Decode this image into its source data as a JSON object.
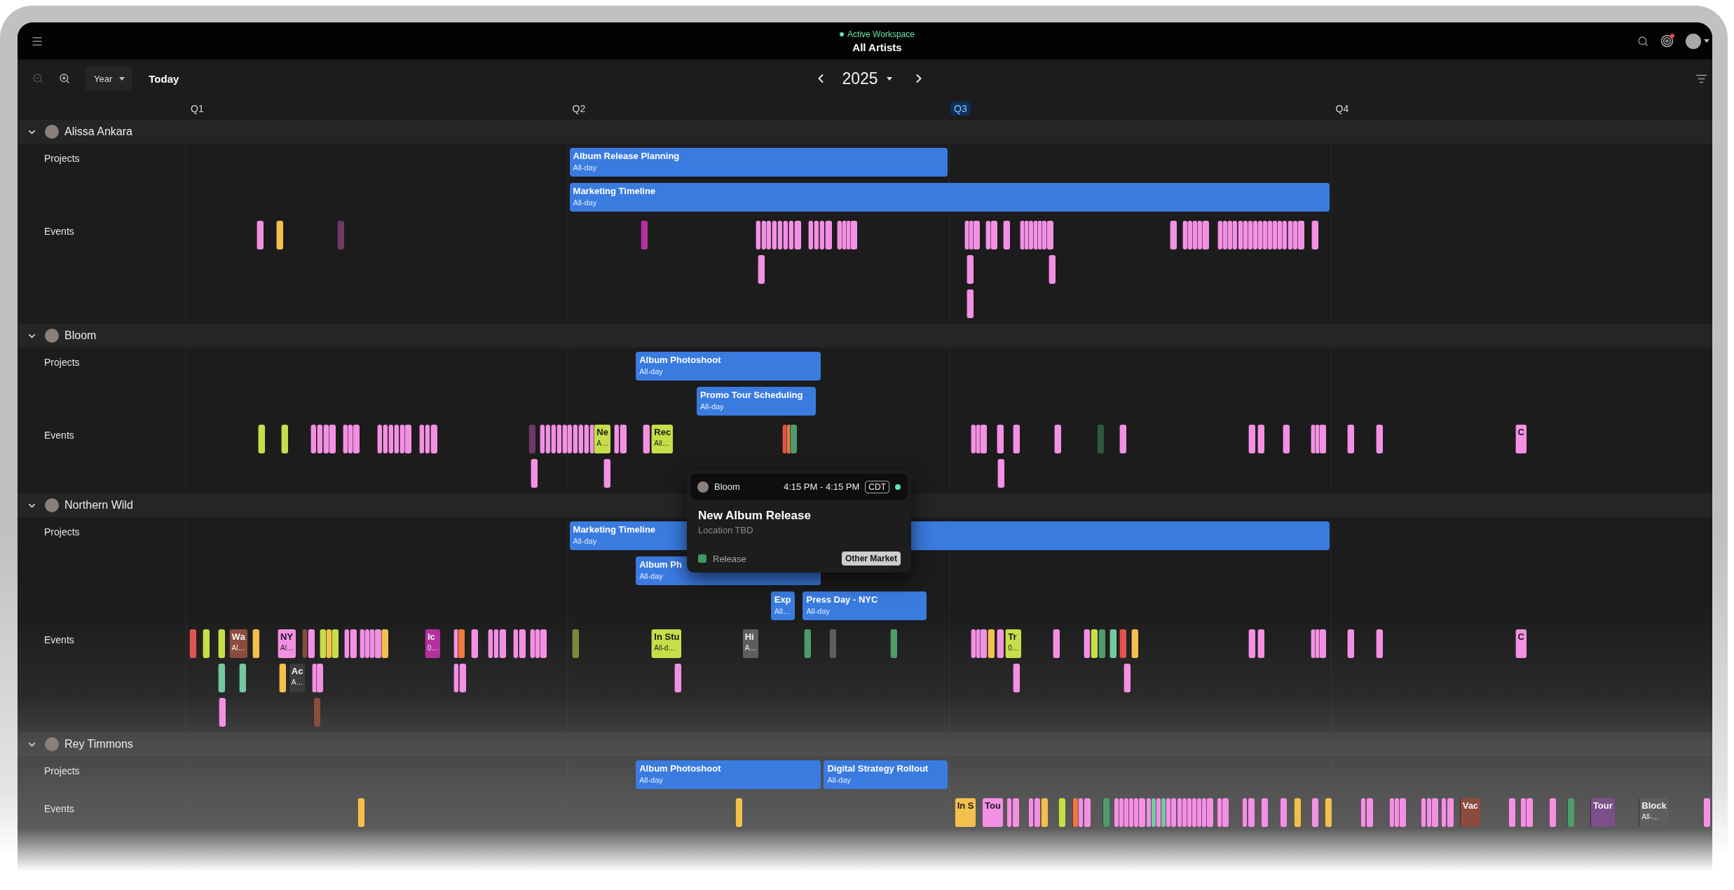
{
  "top_bar": {
    "status": "Active Workspace",
    "active": true,
    "title": "All Artists",
    "unread": true
  },
  "toolbar": {
    "zoom_out_disabled": true,
    "zoom_in_disabled": false,
    "view": "Year",
    "today": "Today",
    "year": "2025"
  },
  "quarters": [
    {
      "label": "Q1",
      "current": false
    },
    {
      "label": "Q2",
      "current": false
    },
    {
      "label": "Q3",
      "current": true
    },
    {
      "label": "Q4",
      "current": false
    }
  ],
  "artists": [
    {
      "name": "Alissa Ankara",
      "expanded": true,
      "projects_label": "Projects",
      "events_label": "Events",
      "projects": [
        {
          "title": "Album Release Planning",
          "subtitle": "All-day"
        },
        {
          "title": "Marketing Timeline",
          "subtitle": "All-day"
        }
      ],
      "events": [
        {
          "color": "#f291e3"
        },
        {
          "color": "#f3c04f"
        },
        {
          "color": "#6c3b64"
        },
        {
          "color": "#b3309d"
        },
        {
          "color": "#f291e3"
        },
        {
          "color": "#f291e3"
        },
        {
          "color": "#f291e3"
        },
        {
          "color": "#f291e3"
        },
        {
          "color": "#f291e3"
        },
        {
          "color": "#f291e3"
        },
        {
          "color": "#f291e3"
        },
        {
          "color": "#f291e3"
        },
        {
          "color": "#f291e3"
        },
        {
          "color": "#f291e3"
        },
        {
          "color": "#f291e3"
        },
        {
          "color": "#f291e3"
        },
        {
          "color": "#f291e3"
        },
        {
          "color": "#f291e3"
        },
        {
          "color": "#f291e3"
        },
        {
          "color": "#f291e3"
        },
        {
          "color": "#f291e3"
        },
        {
          "color": "#f291e3"
        },
        {
          "color": "#f291e3"
        },
        {
          "color": "#f291e3"
        },
        {
          "color": "#f291e3"
        },
        {
          "color": "#f291e3"
        },
        {
          "color": "#f291e3"
        },
        {
          "color": "#f291e3"
        },
        {
          "color": "#f291e3"
        },
        {
          "color": "#f291e3"
        },
        {
          "color": "#f291e3"
        },
        {
          "color": "#f291e3"
        },
        {
          "color": "#f291e3"
        },
        {
          "color": "#f291e3"
        },
        {
          "color": "#f291e3"
        },
        {
          "color": "#f291e3"
        },
        {
          "color": "#f291e3"
        },
        {
          "color": "#f291e3"
        },
        {
          "color": "#f291e3"
        },
        {
          "color": "#f291e3"
        },
        {
          "color": "#f291e3"
        },
        {
          "color": "#f291e3"
        },
        {
          "color": "#f291e3"
        },
        {
          "color": "#f291e3"
        },
        {
          "color": "#f291e3"
        },
        {
          "color": "#f291e3"
        },
        {
          "color": "#f291e3"
        },
        {
          "color": "#f291e3"
        },
        {
          "color": "#f291e3"
        },
        {
          "color": "#f291e3"
        },
        {
          "color": "#f291e3"
        },
        {
          "color": "#f291e3"
        },
        {
          "color": "#f291e3"
        },
        {
          "color": "#f291e3"
        },
        {
          "color": "#f291e3"
        },
        {
          "color": "#f291e3"
        },
        {
          "color": "#f291e3"
        },
        {
          "color": "#f291e3"
        },
        {
          "color": "#f291e3"
        },
        {
          "color": "#f291e3"
        },
        {
          "color": "#f291e3"
        }
      ]
    },
    {
      "name": "Bloom",
      "expanded": true,
      "projects_label": "Projects",
      "events_label": "Events",
      "projects": [
        {
          "title": "Album Photoshoot",
          "subtitle": "All-day"
        },
        {
          "title": "Promo Tour Scheduling",
          "subtitle": "All-day"
        }
      ],
      "events": [
        {
          "color": "#c7de4a"
        },
        {
          "color": "#c7de4a"
        },
        {
          "color": "#f291e3"
        },
        {
          "color": "#f291e3"
        },
        {
          "color": "#f291e3"
        },
        {
          "color": "#f291e3"
        },
        {
          "color": "#f291e3"
        },
        {
          "color": "#f291e3"
        },
        {
          "color": "#f291e3"
        },
        {
          "color": "#f291e3"
        },
        {
          "color": "#f291e3"
        },
        {
          "color": "#f291e3"
        },
        {
          "color": "#f291e3"
        },
        {
          "color": "#f291e3"
        },
        {
          "color": "#f291e3"
        },
        {
          "color": "#f291e3"
        },
        {
          "color": "#f291e3"
        },
        {
          "color": "#f291e3"
        },
        {
          "color": "#6c3b64"
        },
        {
          "color": "#f291e3"
        },
        {
          "color": "#f291e3"
        },
        {
          "color": "#f291e3"
        },
        {
          "color": "#f291e3"
        },
        {
          "color": "#f291e3"
        },
        {
          "color": "#f291e3"
        },
        {
          "color": "#f291e3"
        },
        {
          "color": "#f291e3"
        },
        {
          "color": "#f291e3"
        },
        {
          "color": "#f291e3"
        },
        {
          "color": "#c7de4a",
          "title": "Ne",
          "subtitle": "A…"
        },
        {
          "color": "#f291e3"
        },
        {
          "color": "#f291e3"
        },
        {
          "color": "#f291e3"
        },
        {
          "color": "#c7de4a",
          "title": "Rec",
          "subtitle": "All…"
        },
        {
          "color": "#e0534f"
        },
        {
          "color": "#ee7a3b"
        },
        {
          "color": "#4f9b6b"
        },
        {
          "color": "#f291e3"
        },
        {
          "color": "#f291e3"
        },
        {
          "color": "#f291e3"
        },
        {
          "color": "#f291e3"
        },
        {
          "color": "#f291e3"
        },
        {
          "color": "#f291e3"
        },
        {
          "color": "#2c5a3e"
        },
        {
          "color": "#f291e3"
        },
        {
          "color": "#f291e3"
        },
        {
          "color": "#f291e3"
        },
        {
          "color": "#f291e3"
        },
        {
          "color": "#f291e3"
        },
        {
          "color": "#f291e3"
        },
        {
          "color": "#f291e3"
        },
        {
          "color": "#f291e3"
        },
        {
          "color": "#f291e3"
        },
        {
          "color": "#f291e3",
          "title": "C"
        },
        {
          "color": "#f291e3"
        },
        {
          "color": "#f291e3"
        },
        {
          "color": "#f291e3"
        }
      ]
    },
    {
      "name": "Northern Wild",
      "expanded": true,
      "projects_label": "Projects",
      "events_label": "Events",
      "projects": [
        {
          "title": "Marketing Timeline",
          "subtitle": "All-day"
        },
        {
          "title": "Album Ph",
          "subtitle": "All-day"
        },
        {
          "title": "Exp",
          "subtitle": "All…"
        },
        {
          "title": "Press Day - NYC",
          "subtitle": "All-day"
        }
      ],
      "events": [
        {
          "color": "#e0534f"
        },
        {
          "color": "#c7de4a"
        },
        {
          "color": "#c7de4a"
        },
        {
          "color": "#8b4c3d",
          "title": "Wa",
          "subtitle": "Al…"
        },
        {
          "color": "#f3c04f"
        },
        {
          "color": "#f291e3",
          "title": "NY",
          "subtitle": "Al…"
        },
        {
          "color": "#8b4c3d"
        },
        {
          "color": "#f291e3"
        },
        {
          "color": "#c7de4a"
        },
        {
          "color": "#f3c04f"
        },
        {
          "color": "#c7de4a"
        },
        {
          "color": "#f291e3"
        },
        {
          "color": "#f291e3"
        },
        {
          "color": "#f291e3"
        },
        {
          "color": "#f291e3"
        },
        {
          "color": "#f291e3"
        },
        {
          "color": "#f291e3"
        },
        {
          "color": "#f3c04f"
        },
        {
          "color": "#b3309d",
          "title": "Ic",
          "subtitle": "0…"
        },
        {
          "color": "#f291e3"
        },
        {
          "color": "#ee7a3b"
        },
        {
          "color": "#f291e3"
        },
        {
          "color": "#f291e3"
        },
        {
          "color": "#f291e3"
        },
        {
          "color": "#f291e3"
        },
        {
          "color": "#f291e3"
        },
        {
          "color": "#f291e3"
        },
        {
          "color": "#f291e3"
        },
        {
          "color": "#f291e3"
        },
        {
          "color": "#f291e3"
        },
        {
          "color": "#7a8a3b"
        },
        {
          "color": "#c7de4a",
          "title": "In Stu",
          "subtitle": "All-d…"
        },
        {
          "color": "#5e5e5e",
          "title": "Hi",
          "subtitle": "A…"
        },
        {
          "color": "#4f9b6b"
        },
        {
          "color": "#5e5e5e"
        },
        {
          "color": "#4f9b6b"
        },
        {
          "color": "#f291e3"
        },
        {
          "color": "#f291e3"
        },
        {
          "color": "#f291e3"
        },
        {
          "color": "#f3c04f"
        },
        {
          "color": "#f291e3"
        },
        {
          "color": "#c7de4a",
          "title": "Tr",
          "subtitle": "0…"
        },
        {
          "color": "#f291e3"
        },
        {
          "color": "#f291e3"
        },
        {
          "color": "#c7de4a"
        },
        {
          "color": "#4f9b6b"
        },
        {
          "color": "#74c8a1"
        },
        {
          "color": "#e0534f"
        },
        {
          "color": "#f3c04f"
        },
        {
          "color": "#f291e3"
        },
        {
          "color": "#f291e3"
        },
        {
          "color": "#f291e3"
        },
        {
          "color": "#f291e3"
        },
        {
          "color": "#f291e3"
        },
        {
          "color": "#f291e3"
        },
        {
          "color": "#f291e3"
        },
        {
          "color": "#f291e3",
          "title": "C"
        },
        {
          "color": "#74c8a1"
        },
        {
          "color": "#74c8a1"
        },
        {
          "color": "#f3c04f"
        },
        {
          "color": "#3b3b3b",
          "title": "Ac",
          "subtitle": "A…"
        },
        {
          "color": "#f291e3"
        },
        {
          "color": "#f291e3"
        },
        {
          "color": "#f291e3"
        },
        {
          "color": "#f291e3"
        },
        {
          "color": "#f291e3"
        },
        {
          "color": "#f291e3"
        },
        {
          "color": "#f291e3"
        },
        {
          "color": "#f291e3"
        },
        {
          "color": "#8b4c3d"
        }
      ]
    },
    {
      "name": "Rey Timmons",
      "expanded": true,
      "projects_label": "Projects",
      "events_label": "Events",
      "projects": [
        {
          "title": "Album Photoshoot",
          "subtitle": "All-day"
        },
        {
          "title": "Digital Strategy Rollout",
          "subtitle": "All-day"
        }
      ],
      "events": [
        {
          "color": "#f3c04f"
        },
        {
          "color": "#f3c04f"
        },
        {
          "color": "#f3c04f",
          "title": "In S"
        },
        {
          "color": "#f291e3",
          "title": "Tou"
        },
        {
          "color": "#f291e3"
        },
        {
          "color": "#f291e3"
        },
        {
          "color": "#f291e3"
        },
        {
          "color": "#f291e3"
        },
        {
          "color": "#f3c04f"
        },
        {
          "color": "#c7de4a"
        },
        {
          "color": "#ee7a3b"
        },
        {
          "color": "#f291e3"
        },
        {
          "color": "#f291e3"
        },
        {
          "color": "#4f9b6b"
        },
        {
          "color": "#f291e3"
        },
        {
          "color": "#f291e3"
        },
        {
          "color": "#f291e3"
        },
        {
          "color": "#f291e3"
        },
        {
          "color": "#f291e3"
        },
        {
          "color": "#f291e3"
        },
        {
          "color": "#f291e3"
        },
        {
          "color": "#74c8a1"
        },
        {
          "color": "#f291e3"
        },
        {
          "color": "#74c8a1"
        },
        {
          "color": "#f291e3"
        },
        {
          "color": "#f291e3"
        },
        {
          "color": "#f291e3"
        },
        {
          "color": "#f291e3"
        },
        {
          "color": "#f291e3"
        },
        {
          "color": "#f291e3"
        },
        {
          "color": "#f291e3"
        },
        {
          "color": "#f291e3"
        },
        {
          "color": "#f291e3"
        },
        {
          "color": "#f291e3"
        },
        {
          "color": "#f291e3"
        },
        {
          "color": "#f291e3"
        },
        {
          "color": "#f291e3"
        },
        {
          "color": "#f291e3"
        },
        {
          "color": "#f291e3"
        },
        {
          "color": "#f3c04f"
        },
        {
          "color": "#f291e3"
        },
        {
          "color": "#f3c04f"
        },
        {
          "color": "#f291e3"
        },
        {
          "color": "#f291e3"
        },
        {
          "color": "#f291e3"
        },
        {
          "color": "#f291e3"
        },
        {
          "color": "#f291e3"
        },
        {
          "color": "#f291e3"
        },
        {
          "color": "#f291e3"
        },
        {
          "color": "#f291e3"
        },
        {
          "color": "#f291e3"
        },
        {
          "color": "#f291e3"
        },
        {
          "color": "#8b4c3d",
          "title": "Vac"
        },
        {
          "color": "#f291e3"
        },
        {
          "color": "#f291e3"
        },
        {
          "color": "#f291e3"
        },
        {
          "color": "#f291e3"
        },
        {
          "color": "#4f9b6b"
        },
        {
          "color": "#7c4f8b",
          "title": "Tour"
        },
        {
          "color": "#5e5e5e",
          "title": "Block",
          "subtitle": "All-…"
        },
        {
          "color": "#f291e3"
        }
      ]
    }
  ],
  "popover": {
    "artist": "Bloom",
    "time": "4:15 PM - 4:15 PM",
    "timezone": "CDT",
    "title": "New Album Release",
    "location": "Location TBD",
    "category": {
      "label": "Release",
      "color": "#3f9a62"
    },
    "market": "Other Market"
  }
}
